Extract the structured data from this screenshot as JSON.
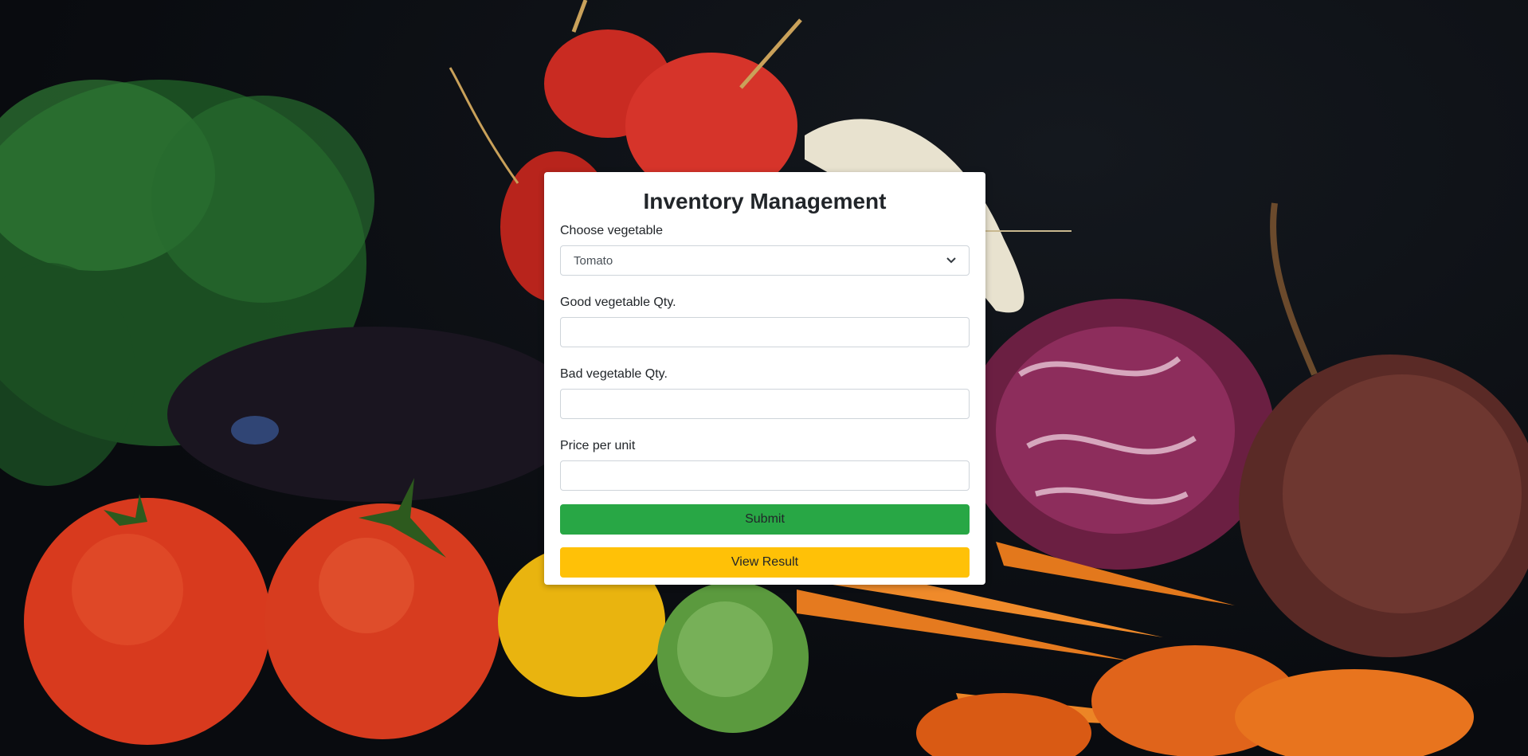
{
  "form": {
    "title": "Inventory Management",
    "vegetable_label": "Choose vegetable",
    "vegetable_selected": "Tomato",
    "good_qty_label": "Good vegetable Qty.",
    "good_qty_value": "",
    "bad_qty_label": "Bad vegetable Qty.",
    "bad_qty_value": "",
    "price_label": "Price per unit",
    "price_value": "",
    "submit_label": "Submit",
    "view_result_label": "View Result"
  },
  "colors": {
    "submit": "#28a745",
    "view_result": "#ffc107",
    "card": "#ffffff",
    "background": "#0b0f14"
  },
  "icons": {
    "select_arrow": "chevron-down-icon"
  }
}
